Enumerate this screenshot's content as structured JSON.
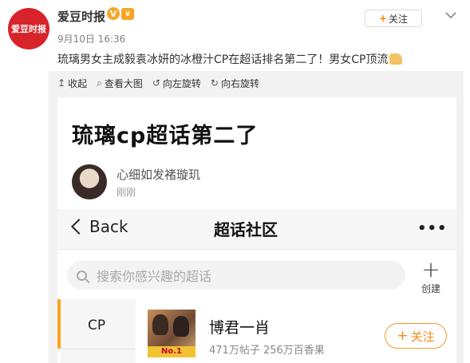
{
  "post": {
    "avatar_text": "爱豆时报",
    "author": "爱豆时报",
    "verified_icon": "V",
    "time": "9月10日 16:36",
    "follow_label": "关注",
    "text": "琉璃男女主成毅袁冰妍的冰橙汁CP在超话排名第二了！男女CP顶流"
  },
  "viewer": {
    "toolbar": [
      {
        "icon": "↥",
        "label": "收起"
      },
      {
        "icon": "⌕",
        "label": "查看大图"
      },
      {
        "icon": "↺",
        "label": "向左旋转"
      },
      {
        "icon": "↻",
        "label": "向右旋转"
      }
    ]
  },
  "screenshot": {
    "title": "琉璃cp超话第二了",
    "user": "心细如发褚璇玑",
    "user_time": "刚刚",
    "nav": {
      "back": "Back",
      "title": "超话社区",
      "more": "•••"
    },
    "search_placeholder": "搜索你感兴趣的超话",
    "create_label": "创建",
    "category": "CP",
    "topic": {
      "name": "博君一肖",
      "stats": "471万帖子 256万百香果",
      "badge": "No.1",
      "follow_label": "关注"
    }
  },
  "colors": {
    "accent_orange": "#ff8200",
    "avatar_red": "#d8232a",
    "category_bar": "#ffa21f"
  }
}
